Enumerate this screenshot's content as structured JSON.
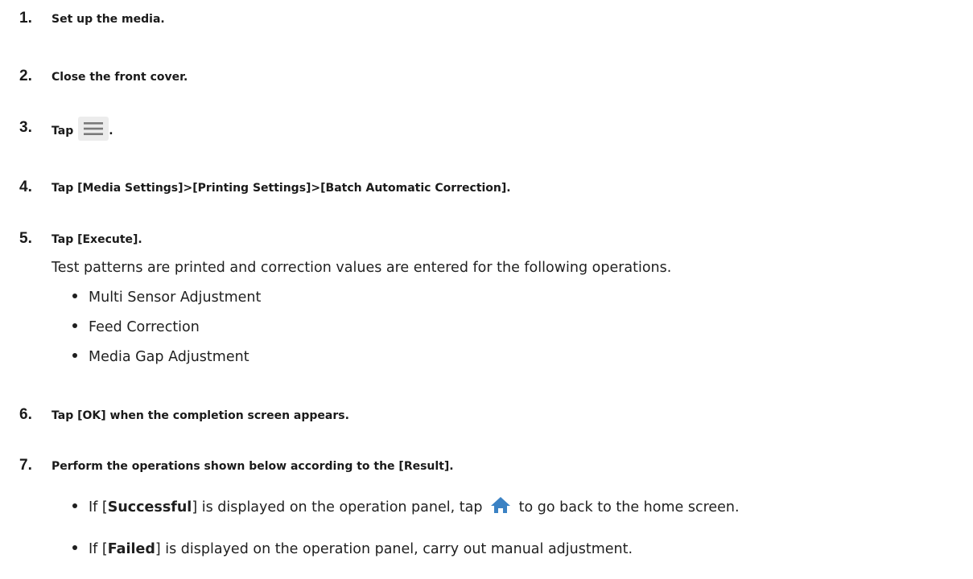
{
  "steps": [
    {
      "num": "1.",
      "text": "Set up the media."
    },
    {
      "num": "2.",
      "text": "Close the front cover."
    },
    {
      "num": "3.",
      "text_before": "Tap",
      "icon": "menu-icon",
      "text_after": "."
    },
    {
      "num": "4.",
      "text": "Tap [Media Settings]>[Printing Settings]>[Batch Automatic Correction]."
    },
    {
      "num": "5.",
      "text": "Tap [Execute].",
      "description": "Test patterns are printed and correction values are entered for the following operations.",
      "bullets": [
        "Multi Sensor Adjustment",
        "Feed Correction",
        "Media Gap Adjustment"
      ]
    },
    {
      "num": "6.",
      "text": "Tap [OK] when the completion screen appears."
    },
    {
      "num": "7.",
      "text": "Perform the operations shown below according to the [Result].",
      "result_items": [
        {
          "prefix": "If [",
          "emph": "Successful",
          "middle": "] is displayed on the operation panel, tap",
          "icon": "home-icon",
          "suffix": "to go back to the home screen."
        },
        {
          "prefix": "If [",
          "emph": "Failed",
          "middle": "] is displayed on the operation panel, carry out manual adjustment."
        }
      ]
    }
  ],
  "colors": {
    "text": "#1a1a1a",
    "icon_gray": "#7a7a7a",
    "home_icon_blue": "#3b82c4",
    "icon_bg": "#ececec"
  }
}
